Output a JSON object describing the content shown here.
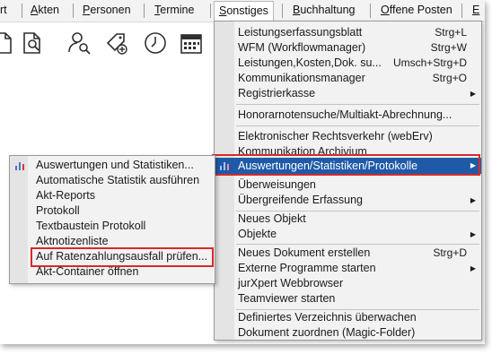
{
  "menubar": {
    "items": [
      "rt",
      "Akten",
      "Personen",
      "Termine",
      "Sonstiges",
      "Buchhaltung",
      "Offene Posten",
      "E"
    ],
    "mnemonics": [
      "",
      "A",
      "P",
      "T",
      "S",
      "B",
      "O",
      "E"
    ]
  },
  "toolbar": {
    "icons": [
      "document-icon",
      "document-search-icon",
      "person-search-icon",
      "tag-add-icon",
      "clock-icon",
      "calendar-icon"
    ]
  },
  "main_menu": {
    "items": [
      {
        "label": "Leistungserfassungsblatt",
        "shortcut": "Strg+L"
      },
      {
        "label": "WFM (Workflowmanager)",
        "shortcut": "Strg+W"
      },
      {
        "label": "Leistungen,Kosten,Dok. su...",
        "shortcut": "Umsch+Strg+D"
      },
      {
        "label": "Kommunikationsmanager",
        "shortcut": "Strg+O"
      },
      {
        "label": "Registrierkasse",
        "shortcut": ""
      },
      {
        "label": "Honorarnotensuche/Multiakt-Abrechnung...",
        "shortcut": ""
      },
      {
        "label": "Elektronischer Rechtsverkehr (webErv)",
        "shortcut": ""
      },
      {
        "label": "Kommunikation Archivium",
        "shortcut": ""
      },
      {
        "label": "Auswertungen/Statistiken/Protokolle",
        "shortcut": ""
      },
      {
        "label": "Überweisungen",
        "shortcut": ""
      },
      {
        "label": "Übergreifende Erfassung",
        "shortcut": ""
      },
      {
        "label": "Neues Objekt",
        "shortcut": ""
      },
      {
        "label": "Objekte",
        "shortcut": ""
      },
      {
        "label": "Neues Dokument erstellen",
        "shortcut": "Strg+D"
      },
      {
        "label": "Externe Programme starten",
        "shortcut": ""
      },
      {
        "label": "jurXpert Webbrowser",
        "shortcut": ""
      },
      {
        "label": "Teamviewer starten",
        "shortcut": ""
      },
      {
        "label": "Definiertes Verzeichnis überwachen",
        "shortcut": ""
      },
      {
        "label": "Dokument zuordnen (Magic-Folder)",
        "shortcut": ""
      }
    ]
  },
  "sub_menu": {
    "items": [
      "Auswertungen und Statistiken...",
      "Automatische Statistik ausführen",
      "Akt-Reports",
      "Protokoll",
      "Textbaustein Protokoll",
      "Aktnotizenliste",
      "Auf Ratenzahlungsausfall prüfen...",
      "Akt-Container öffnen"
    ]
  },
  "colors": {
    "highlight": "#1f5aa8",
    "annotation_box": "#d62a2a"
  }
}
